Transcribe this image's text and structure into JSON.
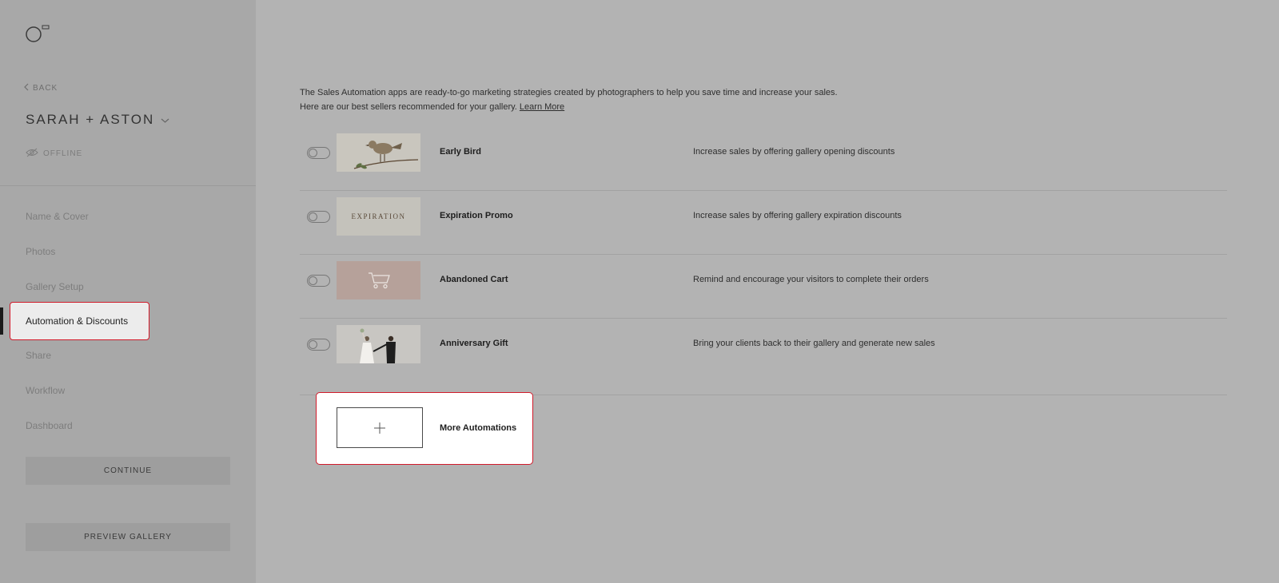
{
  "sidebar": {
    "back_label": "BACK",
    "gallery_title": "SARAH + ASTON",
    "status_label": "OFFLINE",
    "nav": [
      {
        "label": "Name & Cover"
      },
      {
        "label": "Photos"
      },
      {
        "label": "Gallery Setup"
      },
      {
        "label": "Automation & Discounts",
        "active": true
      },
      {
        "label": "Share"
      },
      {
        "label": "Workflow"
      },
      {
        "label": "Dashboard"
      }
    ],
    "continue_label": "CONTINUE",
    "preview_label": "PREVIEW GALLERY"
  },
  "main": {
    "intro_line1": "The Sales Automation apps are ready-to-go marketing strategies created by photographers to help you save time and increase your sales.",
    "intro_line2": "Here are our best sellers recommended for your gallery.",
    "learn_more": "Learn More",
    "automations": [
      {
        "title": "Early Bird",
        "description": "Increase sales by offering gallery opening discounts",
        "enabled": false,
        "icon": "bird-illustration"
      },
      {
        "title": "Expiration Promo",
        "description": "Increase sales by offering gallery expiration discounts",
        "enabled": false,
        "thumb_text": "EXPIRATION"
      },
      {
        "title": "Abandoned Cart",
        "description": "Remind and encourage your visitors to complete their orders",
        "enabled": false,
        "icon": "cart-icon"
      },
      {
        "title": "Anniversary Gift",
        "description": "Bring your clients back to their gallery and generate new sales",
        "enabled": false,
        "icon": "couple-photo"
      }
    ],
    "more_label": "More Automations"
  },
  "colors": {
    "highlight": "#d11a2a",
    "overlay": "#b3b3b3"
  }
}
